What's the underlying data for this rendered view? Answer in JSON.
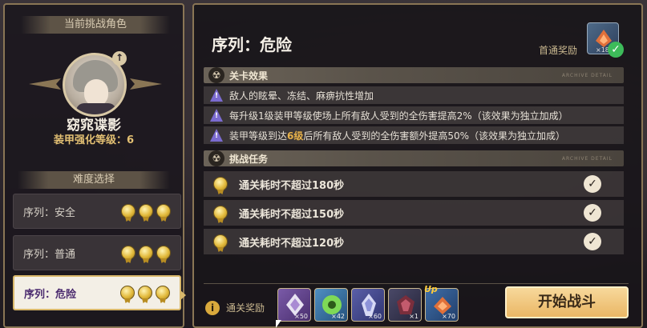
{
  "left": {
    "header": "当前挑战角色",
    "character_name": "窈窕谍影",
    "armor_level_label": "装甲强化等级：6",
    "difficulty_header": "难度选择",
    "difficulties": [
      {
        "label": "序列：安全",
        "medals": 3,
        "selected": false
      },
      {
        "label": "序列：普通",
        "medals": 3,
        "selected": false
      },
      {
        "label": "序列：危险",
        "medals": 3,
        "selected": true
      }
    ]
  },
  "right": {
    "title": "序列：危险",
    "first_reward_label": "首通奖励",
    "first_reward_count": "×18",
    "stage_effect_header": "关卡效果",
    "stage_effect_en": "ARCHIVE DETAIL",
    "effects": [
      {
        "text": "敌人的眩晕、冻结、麻痹抗性增加"
      },
      {
        "text": "每升级1级装甲等级使场上所有敌人受到的全伤害提高2%（该效果为独立加成）"
      },
      {
        "pre": "装甲等级到达",
        "highlight": "6级",
        "post": "后所有敌人受到的全伤害额外提高50%（该效果为独立加成）"
      }
    ],
    "tasks_header": "挑战任务",
    "tasks_en": "ARCHIVE DETAIL",
    "tasks": [
      {
        "text": "通关耗时不超过180秒",
        "done": true
      },
      {
        "text": "通关耗时不超过150秒",
        "done": true
      },
      {
        "text": "通关耗时不超过120秒",
        "done": true
      }
    ],
    "pass_reward_label": "通关奖励",
    "pass_rewards": [
      {
        "icon": "purple-shard-icon",
        "qty": "×50",
        "color": "#5a3d7a"
      },
      {
        "icon": "green-disc-icon",
        "qty": "×42",
        "color": "#2f5f8a"
      },
      {
        "icon": "blue-crystal-icon",
        "qty": "×60",
        "color": "#3b3f7a"
      },
      {
        "icon": "dark-gem-icon",
        "qty": "×1",
        "color": "#3c3b55"
      },
      {
        "icon": "upgrade-emblem-icon",
        "qty": "×70",
        "color": "#2f4d7a",
        "badge": "Up"
      }
    ],
    "start_button": "开始战斗"
  }
}
